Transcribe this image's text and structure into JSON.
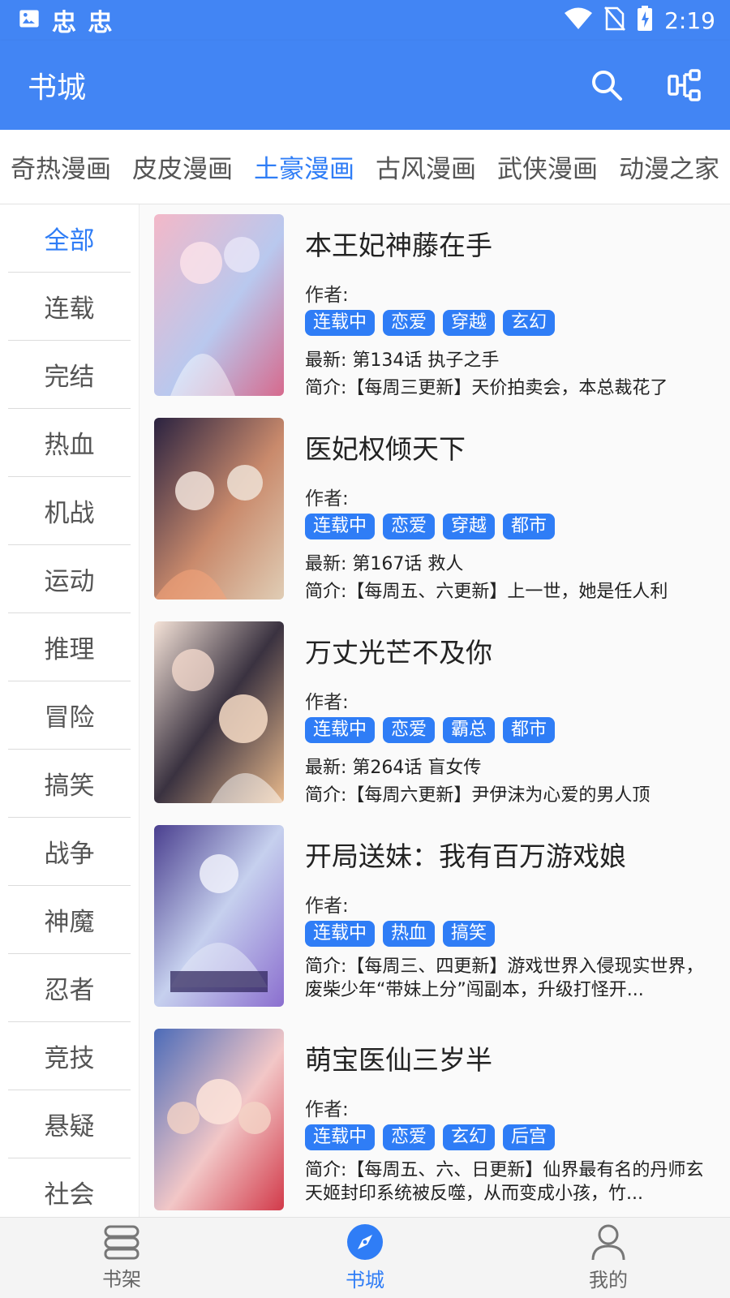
{
  "status_bar": {
    "carrier_text": "忠 忠",
    "time": "2:19"
  },
  "app_bar": {
    "title": "书城"
  },
  "source_tabs": [
    {
      "label": "奇热漫画",
      "active": false
    },
    {
      "label": "皮皮漫画",
      "active": false
    },
    {
      "label": "土豪漫画",
      "active": true
    },
    {
      "label": "古风漫画",
      "active": false
    },
    {
      "label": "武侠漫画",
      "active": false
    },
    {
      "label": "动漫之家",
      "active": false
    }
  ],
  "categories": [
    {
      "label": "全部",
      "active": true
    },
    {
      "label": "连载"
    },
    {
      "label": "完结"
    },
    {
      "label": "热血"
    },
    {
      "label": "机战"
    },
    {
      "label": "运动"
    },
    {
      "label": "推理"
    },
    {
      "label": "冒险"
    },
    {
      "label": "搞笑"
    },
    {
      "label": "战争"
    },
    {
      "label": "神魔"
    },
    {
      "label": "忍者"
    },
    {
      "label": "竞技"
    },
    {
      "label": "悬疑"
    },
    {
      "label": "社会"
    }
  ],
  "books": [
    {
      "title": "本王妃神藤在手",
      "author": "作者:",
      "tags": [
        "连载中",
        "恋爱",
        "穿越",
        "玄幻"
      ],
      "latest": "最新: 第134话 执子之手",
      "intro": "简介:【每周三更新】天价拍卖会，本总裁花了",
      "cover_colors": [
        "#f3b8c8",
        "#b9c8ee",
        "#d66a8d"
      ]
    },
    {
      "title": "医妃权倾天下",
      "author": "作者:",
      "tags": [
        "连载中",
        "恋爱",
        "穿越",
        "都市"
      ],
      "latest": "最新: 第167话 救人",
      "intro": "简介:【每周五、六更新】上一世，她是任人利",
      "cover_colors": [
        "#2a2240",
        "#c98a6c",
        "#e0cdb5"
      ]
    },
    {
      "title": "万丈光芒不及你",
      "author": "作者:",
      "tags": [
        "连载中",
        "恋爱",
        "霸总",
        "都市"
      ],
      "latest": "最新: 第264话 盲女传",
      "intro": "简介:【每周六更新】尹伊沫为心爱的男人顶",
      "cover_colors": [
        "#f5e3d8",
        "#3a3240",
        "#e8b98c"
      ]
    },
    {
      "title": "开局送妹：我有百万游戏娘",
      "author": "作者:",
      "tags": [
        "连载中",
        "热血",
        "搞笑"
      ],
      "latest": "",
      "intro": "简介:【每周三、四更新】游戏世界入侵现实世界，废柴少年“带妹上分”闯副本，升级打怪开...",
      "cover_colors": [
        "#4a3f8f",
        "#c6d0ee",
        "#8b6fcf"
      ]
    },
    {
      "title": "萌宝医仙三岁半",
      "author": "作者:",
      "tags": [
        "连载中",
        "恋爱",
        "玄幻",
        "后宫"
      ],
      "latest": "",
      "intro": "简介:【每周五、六、日更新】仙界最有名的丹师玄天姬封印系统被反噬，从而变成小孩，竹...",
      "cover_colors": [
        "#4c6bb8",
        "#f2c7c7",
        "#d23a4a"
      ]
    }
  ],
  "bottom_nav": [
    {
      "label": "书架",
      "icon": "bookshelf-icon",
      "active": false
    },
    {
      "label": "书城",
      "icon": "compass-icon",
      "active": true
    },
    {
      "label": "我的",
      "icon": "person-icon",
      "active": false
    }
  ],
  "colors": {
    "primary": "#4285f4",
    "accent": "#2f7df6"
  }
}
